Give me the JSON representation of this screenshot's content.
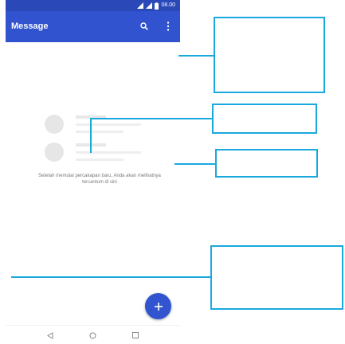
{
  "status_bar": {
    "time": "08.00",
    "icons": [
      "signal-icon",
      "signal-icon",
      "battery-icon"
    ]
  },
  "app_bar": {
    "title": "Message",
    "actions": [
      "search-icon",
      "more-vert-icon"
    ]
  },
  "empty_state": {
    "message": "Setelah memulai percakapan baru, Anda akan melihatnya tercantum di sini"
  },
  "fab": {
    "icon": "plus-icon"
  },
  "nav_bar": {
    "buttons": [
      "back-icon",
      "home-icon",
      "recents-icon"
    ]
  },
  "colors": {
    "app_bar": "#3153cf",
    "status_bar": "#2a48b8",
    "fab": "#3255cf",
    "annotation": "#19a9df"
  }
}
